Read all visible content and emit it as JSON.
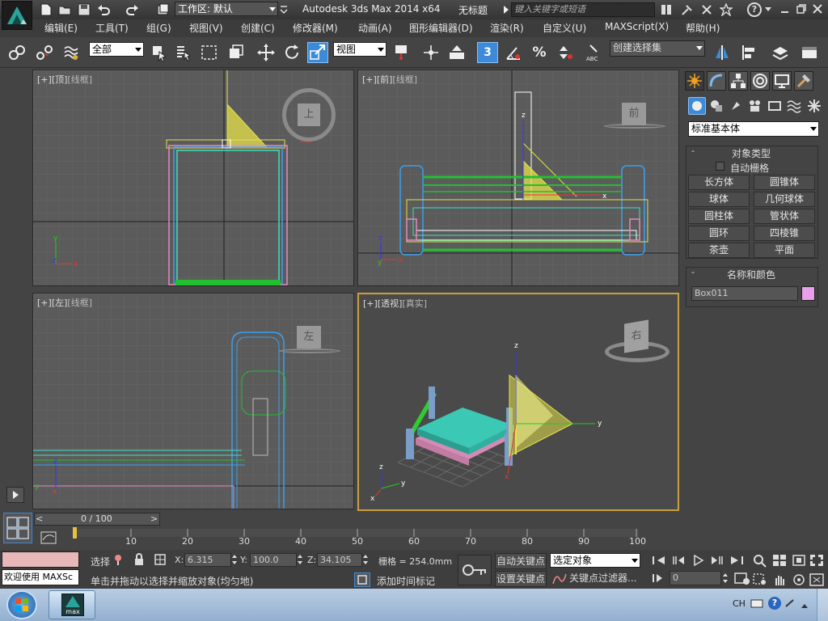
{
  "title_bar": {
    "workspace_label": "工作区: 默认",
    "app_title": "Autodesk 3ds Max  2014 x64",
    "doc_title": "无标题",
    "search_placeholder": "键入关键字或短语"
  },
  "menu": {
    "items": [
      "编辑(E)",
      "工具(T)",
      "组(G)",
      "视图(V)",
      "创建(C)",
      "修改器(M)",
      "动画(A)",
      "图形编辑器(D)",
      "渲染(R)",
      "自定义(U)",
      "MAXScript(X)",
      "帮助(H)"
    ]
  },
  "toolbar": {
    "filter_select": "全部",
    "ref_coord_select": "视图",
    "snap_label": "3",
    "named_selection_placeholder": "创建选择集"
  },
  "viewports": [
    {
      "plus": "[+]",
      "view": "[顶]",
      "shading": "[线框]",
      "cube_label": "上"
    },
    {
      "plus": "[+]",
      "view": "[前]",
      "shading": "[线框]",
      "cube_label": "前"
    },
    {
      "plus": "[+]",
      "view": "[左]",
      "shading": "[线框]",
      "cube_label": "左"
    },
    {
      "plus": "[+]",
      "view": "[透视]",
      "shading": "[真实]",
      "cube_label": "右"
    }
  ],
  "command_panel": {
    "category_select": "标准基本体",
    "object_type_title": "对象类型",
    "auto_grid_label": "自动栅格",
    "objects": [
      "长方体",
      "圆锥体",
      "球体",
      "几何球体",
      "圆柱体",
      "管状体",
      "圆环",
      "四棱锥",
      "茶壶",
      "平面"
    ],
    "name_color_title": "名称和颜色",
    "object_name": "Box011",
    "object_color": "#e8a0e8"
  },
  "timeline": {
    "frame_readout": "0 / 100",
    "ruler_ticks": [
      "10",
      "20",
      "30",
      "40",
      "50",
      "60",
      "70",
      "80",
      "90",
      "100"
    ]
  },
  "status": {
    "maxscript_prompt": "欢迎使用 MAXSc",
    "selection_label": "选择",
    "x_label": "X:",
    "x_value": "6.315",
    "y_label": "Y:",
    "y_value": "100.0",
    "z_label": "Z:",
    "z_value": "34.105",
    "grid_label": "栅格 = 254.0mm",
    "auto_key_label": "自动关键点",
    "key_mode_select": "选定对象",
    "set_key_label": "设置关键点",
    "key_filter_label": "关键点过滤器...",
    "prompt_text": "单击并拖动以选择并缩放对象(均匀地)",
    "add_time_tag_label": "添加时间标记",
    "current_frame": "0"
  },
  "taskbar": {
    "task_label": "max",
    "lang": "CH"
  },
  "colors": {
    "viewport_bg": "#5b5b5b",
    "perspective_bg": "#4a4a4a",
    "active_border": "#c8a040",
    "accent_blue": "#3d8ad8"
  }
}
